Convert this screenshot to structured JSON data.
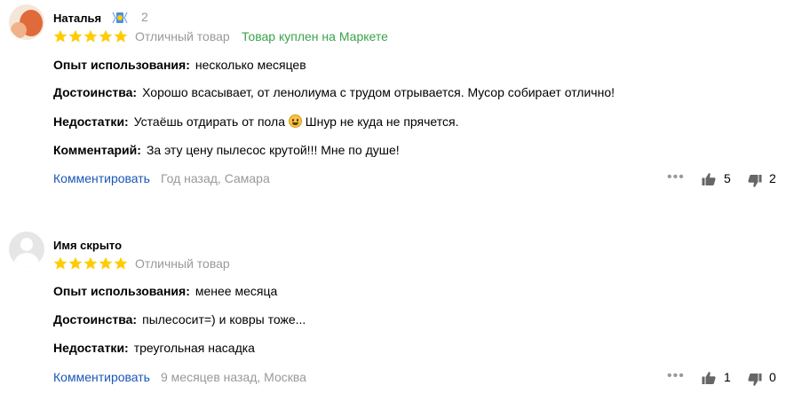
{
  "reviews": [
    {
      "author": "Наталья",
      "badge_count": "2",
      "grade": "Отличный товар",
      "bought": "Товар куплен на Маркете",
      "usage_key": "Опыт использования:",
      "usage_val": "несколько месяцев",
      "pros_key": "Достоинства:",
      "pros_val": "Хорошо всасывает, от ленолиума с трудом отрывается. Мусор собирает отлично!",
      "cons_key": "Недостатки:",
      "cons_val_before": "Устаёшь отдирать от пола",
      "cons_val_after": "Шнур не куда не прячется.",
      "comment_key": "Комментарий:",
      "comment_val": "За эту цену пылесос крутой!!! Мне по душе!",
      "comment_link": "Комментировать",
      "meta": "Год назад, Самара",
      "likes": "5",
      "dislikes": "2",
      "stars": 5
    },
    {
      "author": "Имя скрыто",
      "grade": "Отличный товар",
      "usage_key": "Опыт использования:",
      "usage_val": "менее месяца",
      "pros_key": "Достоинства:",
      "pros_val": "пылесосит=) и ковры тоже...",
      "cons_key": "Недостатки:",
      "cons_val": "треугольная насадка",
      "comment_link": "Комментировать",
      "meta": "9 месяцев назад, Москва",
      "likes": "1",
      "dislikes": "0",
      "stars": 5
    }
  ],
  "more_icon": "ellipsis-icon",
  "colors": {
    "star": "#ffcc00",
    "link": "#1a56b8",
    "bought": "#3aa34a",
    "muted": "#999999"
  }
}
